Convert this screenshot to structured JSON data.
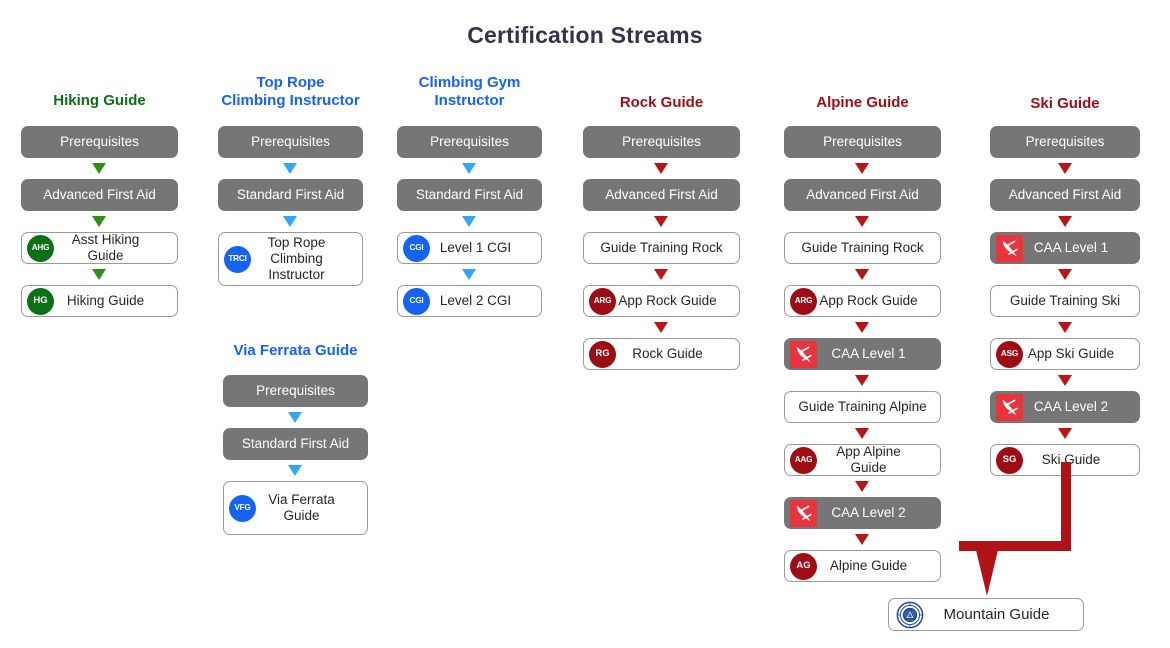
{
  "title": "Certification Streams",
  "colors": {
    "title": "#33334d",
    "green": "#0b7016",
    "blue": "#1463f3",
    "dark_red": "#9e0d14",
    "grey_box": "#767676",
    "arrow_green": "#2e9114",
    "arrow_blue": "#35a6f5",
    "arrow_red": "#b81616",
    "connector_red": "#b01317",
    "avalanche_red": "#e8343c",
    "seal_blue": "#1a4fa0"
  },
  "streams": [
    {
      "id": "hiking-guide",
      "title": "Hiking Guide",
      "title_color": "#0b7016",
      "arrow_color": "#2e9114",
      "nodes": [
        {
          "label": "Prerequisites",
          "style": "grey",
          "icon": null
        },
        {
          "label": "Advanced First Aid",
          "style": "grey",
          "icon": null
        },
        {
          "label": "Asst Hiking Guide",
          "style": "white",
          "icon": {
            "type": "badge",
            "text": "AHG",
            "color": "green"
          }
        },
        {
          "label": "Hiking Guide",
          "style": "white",
          "icon": {
            "type": "badge",
            "text": "HG",
            "color": "green"
          }
        }
      ]
    },
    {
      "id": "top-rope-climbing-instructor",
      "title": "Top Rope\nClimbing Instructor",
      "title_color": "#1463f3",
      "arrow_color": "#35a6f5",
      "nodes": [
        {
          "label": "Prerequisites",
          "style": "grey",
          "icon": null
        },
        {
          "label": "Standard First Aid",
          "style": "grey",
          "icon": null
        },
        {
          "label": "Top Rope\nClimbing Instructor",
          "style": "white",
          "icon": {
            "type": "badge",
            "text": "TRCI",
            "color": "blue"
          }
        }
      ]
    },
    {
      "id": "climbing-gym-instructor",
      "title": "Climbing Gym\nInstructor",
      "title_color": "#1463f3",
      "arrow_color": "#35a6f5",
      "nodes": [
        {
          "label": "Prerequisites",
          "style": "grey",
          "icon": null
        },
        {
          "label": "Standard First Aid",
          "style": "grey",
          "icon": null
        },
        {
          "label": "Level 1 CGI",
          "style": "white",
          "icon": {
            "type": "badge",
            "text": "CGI",
            "color": "blue"
          }
        },
        {
          "label": "Level 2 CGI",
          "style": "white",
          "icon": {
            "type": "badge",
            "text": "CGI",
            "color": "blue"
          }
        }
      ]
    },
    {
      "id": "rock-guide",
      "title": "Rock Guide",
      "title_color": "#9e0d14",
      "arrow_color": "#b81616",
      "nodes": [
        {
          "label": "Prerequisites",
          "style": "grey",
          "icon": null
        },
        {
          "label": "Advanced First Aid",
          "style": "grey",
          "icon": null
        },
        {
          "label": "Guide Training Rock",
          "style": "white",
          "icon": null
        },
        {
          "label": "App Rock Guide",
          "style": "white",
          "icon": {
            "type": "badge",
            "text": "ARG",
            "color": "darkred"
          }
        },
        {
          "label": "Rock Guide",
          "style": "white",
          "icon": {
            "type": "badge",
            "text": "RG",
            "color": "darkred"
          }
        }
      ]
    },
    {
      "id": "alpine-guide",
      "title": "Alpine Guide",
      "title_color": "#9e0d14",
      "arrow_color": "#b81616",
      "nodes": [
        {
          "label": "Prerequisites",
          "style": "grey",
          "icon": null
        },
        {
          "label": "Advanced First Aid",
          "style": "grey",
          "icon": null
        },
        {
          "label": "Guide Training Rock",
          "style": "white",
          "icon": null
        },
        {
          "label": "App Rock Guide",
          "style": "white",
          "icon": {
            "type": "badge",
            "text": "ARG",
            "color": "darkred"
          }
        },
        {
          "label": "CAA Level 1",
          "style": "grey",
          "icon": {
            "type": "avalanche"
          }
        },
        {
          "label": "Guide Training Alpine",
          "style": "white",
          "icon": null
        },
        {
          "label": "App Alpine Guide",
          "style": "white",
          "icon": {
            "type": "badge",
            "text": "AAG",
            "color": "darkred"
          }
        },
        {
          "label": "CAA Level 2",
          "style": "grey",
          "icon": {
            "type": "avalanche"
          }
        },
        {
          "label": "Alpine Guide",
          "style": "white",
          "icon": {
            "type": "badge",
            "text": "AG",
            "color": "darkred"
          }
        }
      ]
    },
    {
      "id": "ski-guide",
      "title": "Ski Guide",
      "title_color": "#9e0d14",
      "arrow_color": "#b81616",
      "nodes": [
        {
          "label": "Prerequisites",
          "style": "grey",
          "icon": null
        },
        {
          "label": "Advanced First Aid",
          "style": "grey",
          "icon": null
        },
        {
          "label": "CAA Level 1",
          "style": "grey",
          "icon": {
            "type": "avalanche"
          }
        },
        {
          "label": "Guide Training Ski",
          "style": "white",
          "icon": null
        },
        {
          "label": "App Ski Guide",
          "style": "white",
          "icon": {
            "type": "badge",
            "text": "ASG",
            "color": "darkred"
          }
        },
        {
          "label": "CAA Level 2",
          "style": "grey",
          "icon": {
            "type": "avalanche"
          }
        },
        {
          "label": "Ski Guide",
          "style": "white",
          "icon": {
            "type": "badge",
            "text": "SG",
            "color": "darkred"
          }
        }
      ]
    }
  ],
  "final": {
    "label": "Mountain Guide",
    "icon": "acmg-seal-icon"
  }
}
